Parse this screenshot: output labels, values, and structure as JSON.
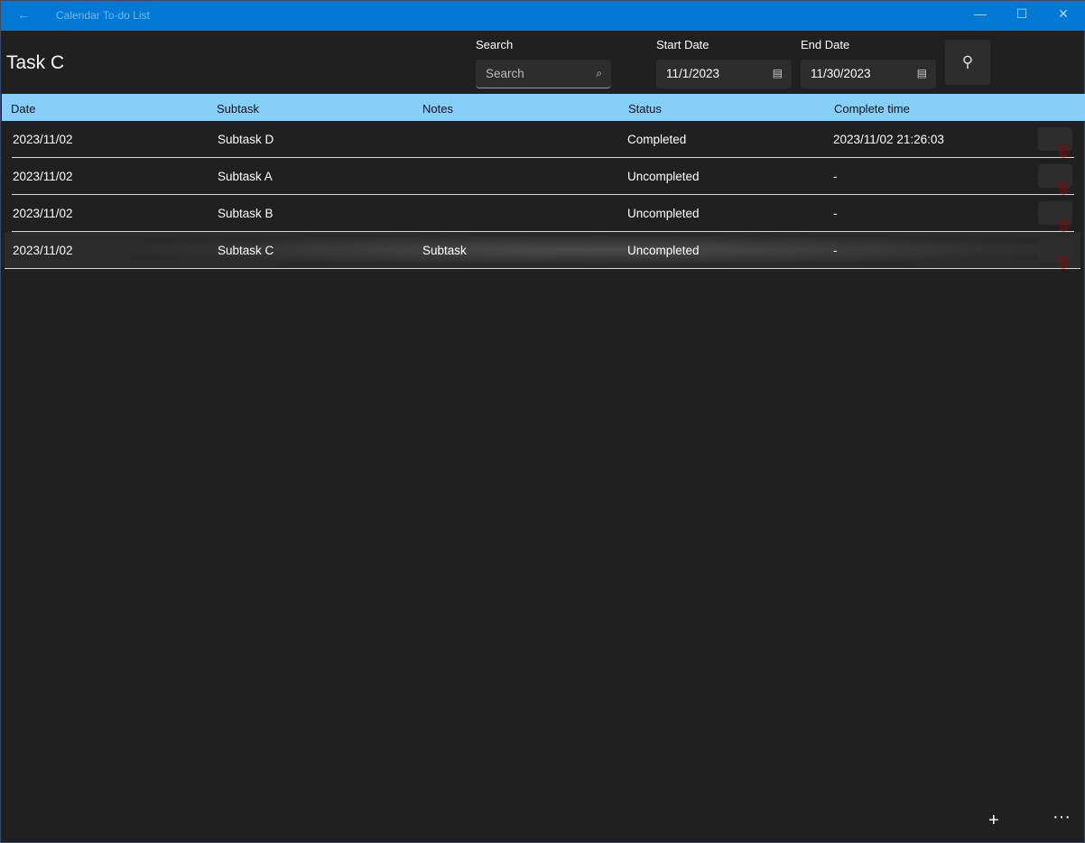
{
  "window": {
    "title": "Calendar To-do List"
  },
  "page": {
    "title": "Task C"
  },
  "filters": {
    "search_label": "Search",
    "search_placeholder": "Search",
    "start_label": "Start Date",
    "start_value": "11/1/2023",
    "end_label": "End Date",
    "end_value": "11/30/2023"
  },
  "table": {
    "headers": [
      "Date",
      "Subtask",
      "Notes",
      "Status",
      "Complete time"
    ],
    "rows": [
      {
        "date": "2023/11/02",
        "subtask": "Subtask D",
        "notes": "",
        "status": "Completed",
        "complete": "2023/11/02 21:26:03"
      },
      {
        "date": "2023/11/02",
        "subtask": "Subtask A",
        "notes": "",
        "status": "Uncompleted",
        "complete": "-"
      },
      {
        "date": "2023/11/02",
        "subtask": "Subtask B",
        "notes": "",
        "status": "Uncompleted",
        "complete": "-"
      },
      {
        "date": "2023/11/02",
        "subtask": "Subtask C",
        "notes": "Subtask",
        "status": "Uncompleted",
        "complete": "-"
      }
    ]
  },
  "colors": {
    "titlebar": "#0078d4",
    "header": "#87cefa",
    "delete": "#e00000"
  }
}
